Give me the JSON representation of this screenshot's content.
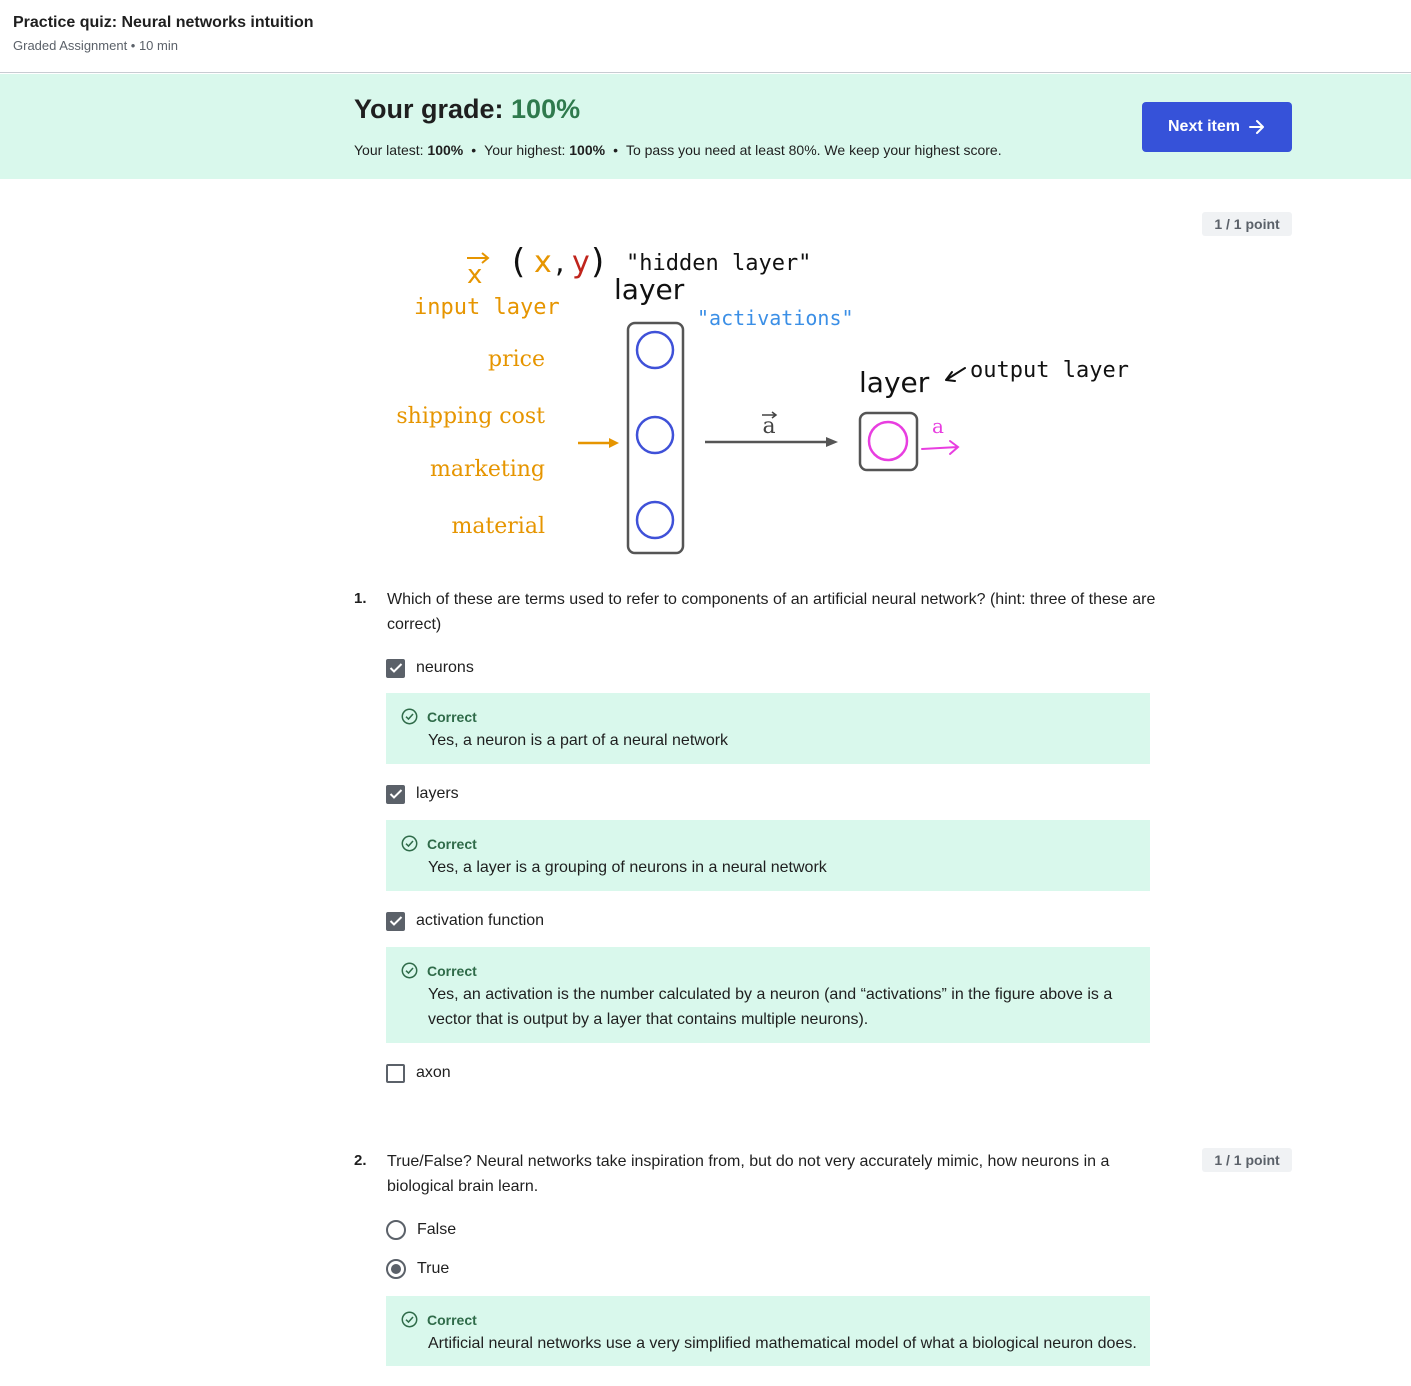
{
  "header": {
    "title": "Practice quiz: Neural networks intuition",
    "subtitle": "Graded Assignment • 10 min"
  },
  "grade": {
    "label": "Your grade: ",
    "value": "100%",
    "latest_label": "Your latest: ",
    "latest_value": "100%",
    "highest_label": "Your highest: ",
    "highest_value": "100%",
    "pass_note": "To pass you need at least 80%. We keep your highest score.",
    "next_button": "Next item"
  },
  "colors": {
    "accent": "#3652d9",
    "success_bg": "#d9f8ec",
    "success_text": "#2f6b49",
    "orange": "#e69500",
    "blue": "#3f51d8",
    "magenta": "#e83ee0"
  },
  "figure": {
    "x_vec": "x",
    "xy_open": "(",
    "xy_x": "x",
    "xy_comma": ",",
    "xy_y": "y",
    "xy_close": ")",
    "hidden_layer": "\"hidden layer\"",
    "layer_top": "layer",
    "input_layer": "input layer",
    "activations": "\"activations\"",
    "features": [
      "price",
      "shipping cost",
      "marketing",
      "material"
    ],
    "a_vec": "a",
    "layer_out": "layer",
    "output_layer": "output layer",
    "a_out": "a"
  },
  "questions": [
    {
      "number": "1.",
      "points": "1 / 1 point",
      "text": "Which of these are terms used to refer to components of an artificial neural network? (hint: three of these are correct)",
      "options": [
        {
          "label": "neurons",
          "checked": true,
          "feedback_label": "Correct",
          "feedback": "Yes, a neuron is a part of a neural network"
        },
        {
          "label": "layers",
          "checked": true,
          "feedback_label": "Correct",
          "feedback": "Yes, a layer is a grouping of neurons in a neural network"
        },
        {
          "label": "activation function",
          "checked": true,
          "feedback_label": "Correct",
          "feedback": "Yes, an activation is the number calculated by a neuron (and “activations” in the figure above is a vector that is output by a layer that contains multiple neurons)."
        },
        {
          "label": "axon",
          "checked": false
        }
      ]
    },
    {
      "number": "2.",
      "points": "1 / 1 point",
      "text": "True/False? Neural networks take inspiration from, but do not very accurately mimic, how neurons in a biological brain learn.",
      "options": [
        {
          "label": "False",
          "selected": false
        },
        {
          "label": "True",
          "selected": true,
          "feedback_label": "Correct",
          "feedback": "Artificial neural networks use a very simplified mathematical model of what a biological neuron does."
        }
      ]
    }
  ]
}
